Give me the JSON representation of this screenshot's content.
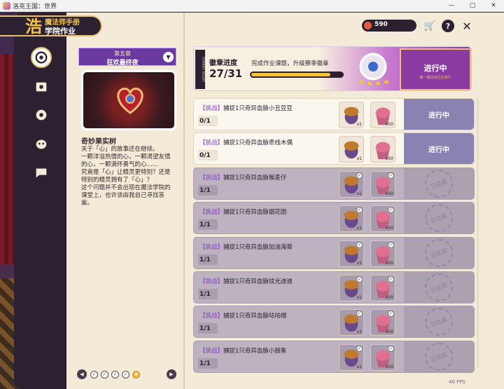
{
  "window": {
    "title": "洛克王国：世界",
    "min": "—",
    "max": "▢",
    "close": "✕"
  },
  "logo": {
    "mark": "浩",
    "line1": "魔法师手册",
    "line2": "学院作业"
  },
  "sidebar": {
    "items": [
      {
        "name": "target",
        "active": true
      },
      {
        "name": "card"
      },
      {
        "name": "gear-badge"
      },
      {
        "name": "pet"
      },
      {
        "name": "chat"
      }
    ]
  },
  "chapter": {
    "number": "第五章",
    "title": "狂欢最终夜",
    "story_title": "奇妙果实树",
    "story_body": "关于「心」的故事还在继续。\n一颗洋溢热情的心，一颗渴望友情的心，一颗满怀勇气的心……\n究竟是「心」让精灵更特别？还是特别的精灵拥有了「心」？\n这个问题并不会出现在魔法学院的课堂上，也许该由我自己寻找答案。"
  },
  "pager": {
    "prev": "◀",
    "next": "▶",
    "dots": [
      "✓",
      "✓",
      "✓",
      "✓",
      "★"
    ]
  },
  "currency": {
    "amount": "590"
  },
  "topbar": {
    "shop": "🛒",
    "help": "?",
    "close": "✕"
  },
  "progress": {
    "side": "STARRY NIGHT",
    "title": "徽章进度",
    "desc": "完成作业课题，升级赛季徽章",
    "current": 27,
    "total": 31,
    "count_text": "27/31",
    "fill": 0.87,
    "status": "进行中",
    "sub": "第一期活动正在进行"
  },
  "tasks": [
    {
      "tag": "【挑战】",
      "text": "捕捉1只奇异血脉小丑豆豆",
      "count": "0/1",
      "state": "active",
      "status": "进行中",
      "r1": "x1",
      "r2": "x50"
    },
    {
      "tag": "【挑战】",
      "text": "捕捉1只奇异血脉牵线木偶",
      "count": "0/1",
      "state": "active",
      "status": "进行中",
      "r1": "x1",
      "r2": "x50"
    },
    {
      "tag": "【挑战】",
      "text": "捕捉1只奇异血脉猴麦仔",
      "count": "1/1",
      "state": "done",
      "status": "已达成",
      "r1": "x1",
      "r2": "x50"
    },
    {
      "tag": "【挑战】",
      "text": "捕捉1只奇异血脉烟花团",
      "count": "1/1",
      "state": "done",
      "status": "已达成",
      "r1": "x1",
      "r2": "x50"
    },
    {
      "tag": "【挑战】",
      "text": "捕捉1只奇异血脉加油海葵",
      "count": "1/1",
      "state": "done",
      "status": "已达成",
      "r1": "x1",
      "r2": "x50"
    },
    {
      "tag": "【挑战】",
      "text": "捕捉1只奇异血脉炫光迪迪",
      "count": "1/1",
      "state": "done",
      "status": "已达成",
      "r1": "x1",
      "r2": "x50"
    },
    {
      "tag": "【挑战】",
      "text": "捕捉1只奇异血脉咕咕帽",
      "count": "1/1",
      "state": "done",
      "status": "已达成",
      "r1": "x1",
      "r2": "x50"
    },
    {
      "tag": "【挑战】",
      "text": "捕捉1只奇异血脉小鼓象",
      "count": "1/1",
      "state": "done",
      "status": "已达成",
      "r1": "x1",
      "r2": "x50"
    }
  ],
  "fps": "40 FPS",
  "colors": {
    "accent": "#8a3aa0",
    "gold": "#e8c070",
    "active_status": "#8a82b0",
    "done_row": "#bdb2bf"
  }
}
